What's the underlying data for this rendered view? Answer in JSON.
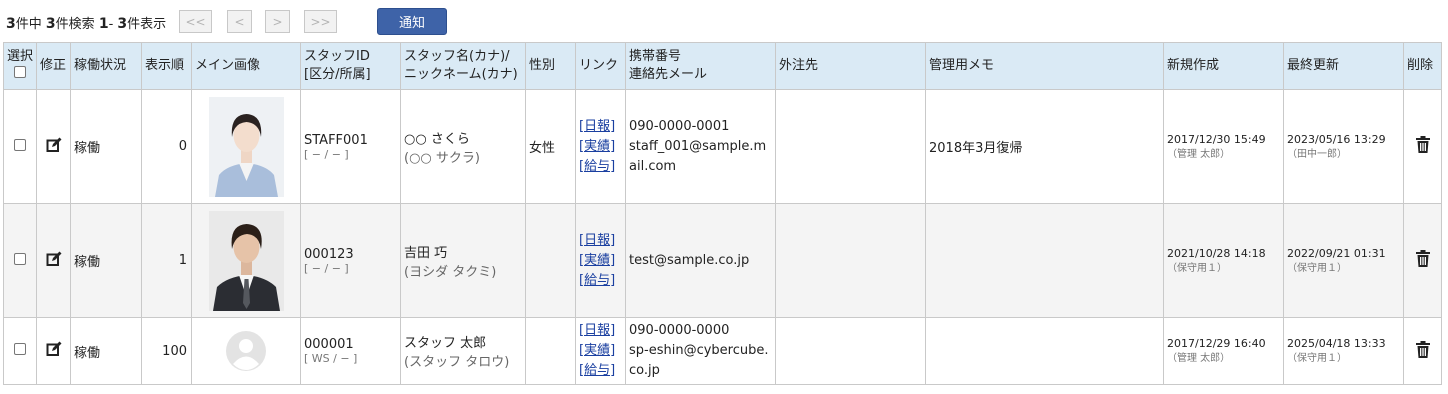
{
  "summary": {
    "total_count": "3",
    "total_label": "件中",
    "search_count": "3",
    "search_label": "件検索",
    "range_start": "1",
    "range_sep": "-",
    "range_end": "3",
    "range_label": "件表示"
  },
  "pager": {
    "first": "<<",
    "prev": "<",
    "next": ">",
    "last": ">>"
  },
  "notify_button": "通知",
  "columns": {
    "select": "選択",
    "edit": "修正",
    "status": "稼働状況",
    "order": "表示順",
    "image": "メイン画像",
    "staff_id_line1": "スタッフID",
    "staff_id_line2": "[区分/所属]",
    "name_line1": "スタッフ名(カナ)/",
    "name_line2": "ニックネーム(カナ)",
    "gender": "性別",
    "link": "リンク",
    "contact_line1": "携帯番号",
    "contact_line2": "連絡先メール",
    "outsource": "外注先",
    "memo": "管理用メモ",
    "created": "新規作成",
    "updated": "最終更新",
    "delete": "削除"
  },
  "rows": [
    {
      "status": "稼働",
      "order": "0",
      "image": "female-staff-photo",
      "staff_id": "STAFF001",
      "staff_group": "[ − / − ]",
      "name": "○○ さくら",
      "kana": "(○○ サクラ)",
      "gender": "女性",
      "links": [
        "[日報]",
        "[実績]",
        "[給与]"
      ],
      "phone": "090-0000-0001",
      "email": "staff_001@sample.mail.com",
      "outsource": "",
      "memo": "2018年3月復帰",
      "created": "2017/12/30 15:49",
      "created_by": "（管理 太郎）",
      "updated": "2023/05/16 13:29",
      "updated_by": "（田中一郎）"
    },
    {
      "status": "稼働",
      "order": "1",
      "image": "male-staff-photo",
      "staff_id": "000123",
      "staff_group": "[ − / − ]",
      "name": "吉田 巧",
      "kana": "(ヨシダ タクミ)",
      "gender": "",
      "links": [
        "[日報]",
        "[実績]",
        "[給与]"
      ],
      "phone": "",
      "email": "test@sample.co.jp",
      "outsource": "",
      "memo": "",
      "created": "2021/10/28 14:18",
      "created_by": "（保守用１）",
      "updated": "2022/09/21 01:31",
      "updated_by": "（保守用１）"
    },
    {
      "status": "稼働",
      "order": "100",
      "image": "default-avatar",
      "staff_id": "000001",
      "staff_group": "[ WS / − ]",
      "name": "スタッフ 太郎",
      "kana": "(スタッフ タロウ)",
      "gender": "",
      "links": [
        "[日報]",
        "[実績]",
        "[給与]"
      ],
      "phone": "090-0000-0000",
      "email": "sp-eshin@cybercube.co.jp",
      "outsource": "",
      "memo": "",
      "created": "2017/12/29 16:40",
      "created_by": "（管理 太郎）",
      "updated": "2025/04/18 13:33",
      "updated_by": "（保守用１）"
    }
  ],
  "icons": {
    "edit": "edit-icon",
    "delete": "trash-icon",
    "checkbox": "checkbox"
  },
  "colors": {
    "header_bg": "#daeaf5",
    "button_bg": "#3e63a8",
    "link": "#1a3fa0",
    "alt_row": "#f4f4f4"
  }
}
